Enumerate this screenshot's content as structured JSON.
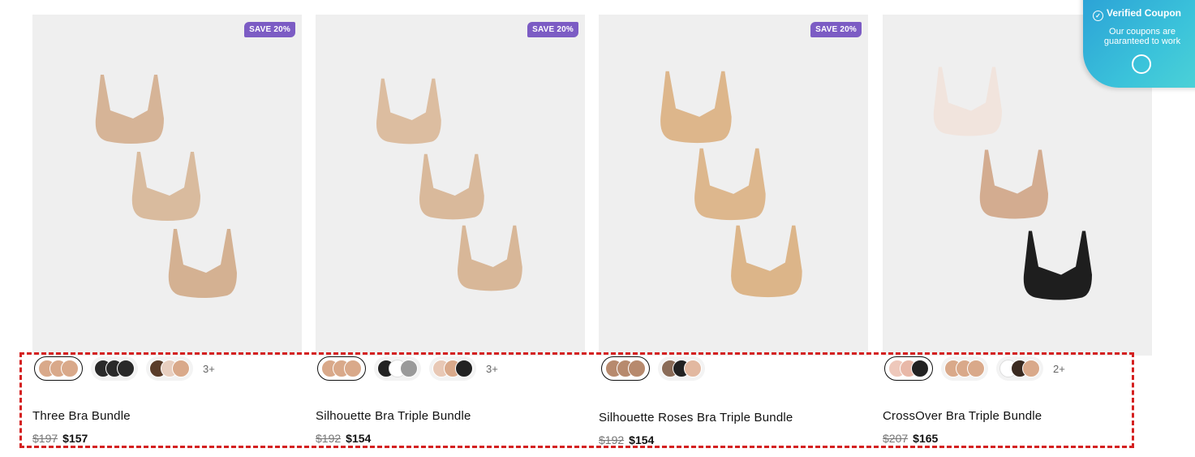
{
  "products": [
    {
      "badge": "SAVE 20%",
      "name": "Three Bra Bundle",
      "old_price": "$197",
      "new_price": "$157",
      "more": "3+",
      "bra_colors": [
        "#d6b497",
        "#d9bb9e",
        "#d4b192"
      ],
      "swatches": [
        [
          "#d9a98a",
          "#d9a98a",
          "#d9a98a"
        ],
        [
          "#2a2a2a",
          "#2a2a2a",
          "#2a2a2a"
        ],
        [
          "#5a3d2a",
          "#e8cfc0",
          "#d9a98a"
        ]
      ]
    },
    {
      "badge": "SAVE 20%",
      "name": "Silhouette Bra Triple Bundle",
      "old_price": "$192",
      "new_price": "$154",
      "more": "3+",
      "bra_colors": [
        "#dcbda0",
        "#d9b99b",
        "#d8b798"
      ],
      "swatches": [
        [
          "#d9a98a",
          "#d9a98a",
          "#d9a98a"
        ],
        [
          "#222222",
          "#ffffff",
          "#9a9a9a"
        ],
        [
          "#e8c8b5",
          "#d9a98a",
          "#222222"
        ]
      ]
    },
    {
      "badge": "SAVE 20%",
      "name": "Silhouette Roses Bra Triple Bundle",
      "old_price": "$192",
      "new_price": "$154",
      "more": "",
      "bra_colors": [
        "#ddb68b",
        "#ddb78d",
        "#dcb589"
      ],
      "swatches": [
        [
          "#b78a6e",
          "#b78a6e",
          "#b78a6e"
        ],
        [
          "#8a6b57",
          "#222222",
          "#e2b8a0"
        ]
      ]
    },
    {
      "badge": "",
      "name": "CrossOver Bra Triple Bundle",
      "old_price": "$207",
      "new_price": "$165",
      "more": "2+",
      "bra_colors": [
        "#f1e4dd",
        "#d3ac90",
        "#1e1e1e"
      ],
      "swatches": [
        [
          "#eec8bb",
          "#e8b8a8",
          "#222222"
        ],
        [
          "#d9a98a",
          "#d9a98a",
          "#d9a98a"
        ],
        [
          "#ffffff",
          "#3a2a20",
          "#d9a98a"
        ]
      ]
    }
  ],
  "coupon": {
    "title": "Verified Coupon",
    "subtitle": "Our coupons are guaranteed to work"
  }
}
